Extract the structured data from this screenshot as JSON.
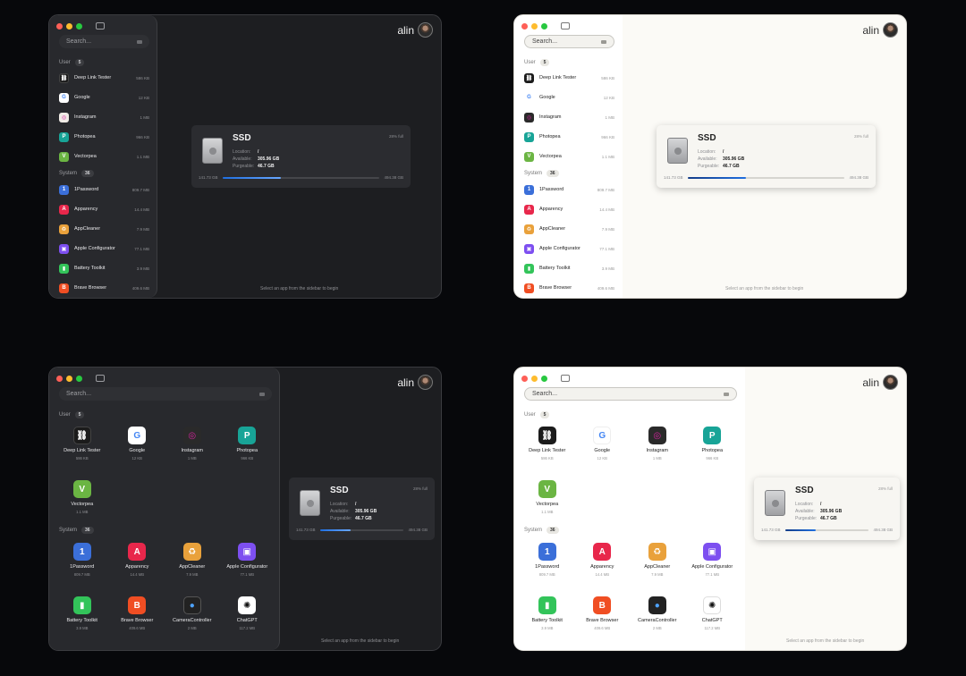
{
  "search_placeholder": "Search...",
  "user": {
    "name": "alin"
  },
  "sections": {
    "user": {
      "label": "User",
      "count": "5"
    },
    "system": {
      "label": "System",
      "count": "36"
    }
  },
  "apps": {
    "deep_link_tester": {
      "name": "Deep Link Tester",
      "size": "586 KB"
    },
    "google": {
      "name": "Google",
      "size": "12 KB"
    },
    "instagram": {
      "name": "Instagram",
      "size": "1 MB"
    },
    "photopea": {
      "name": "Photopea",
      "size": "966 KB"
    },
    "vectorpea": {
      "name": "Vectorpea",
      "size": "1.1 MB"
    },
    "onepassword": {
      "name": "1Password",
      "size": "809.7 MB"
    },
    "apparency": {
      "name": "Apparency",
      "size": "14.4 MB"
    },
    "appcleaner": {
      "name": "AppCleaner",
      "size": "7.9 MB"
    },
    "apple_configurator": {
      "name": "Apple Configurator",
      "size": "77.1 MB"
    },
    "battery_toolkit": {
      "name": "Battery Toolkit",
      "size": "3.9 MB"
    },
    "brave_browser": {
      "name": "Brave Browser",
      "size": "409.6 MB"
    },
    "camera_controller": {
      "name": "CameraController",
      "size": "2 MB"
    },
    "chatgpt": {
      "name": "ChatGPT",
      "size": "117.2 MB"
    }
  },
  "disk": {
    "title": "SSD",
    "percent_full_label": "28% full",
    "percent_full": 0.28,
    "location_label": "Location:",
    "location_value": "/",
    "available_label": "Available:",
    "available_value": "305.96 GB",
    "purgeable_label": "Purgeable:",
    "purgeable_value": "46.7 GB",
    "used": "141.73 GB",
    "total": "494.38 GB"
  },
  "hint": "Select an app from the sidebar to begin",
  "colors": {
    "accent": "#1f6fe0",
    "dark_bg": "#1d1e21",
    "light_bg": "#fbfaf6"
  }
}
